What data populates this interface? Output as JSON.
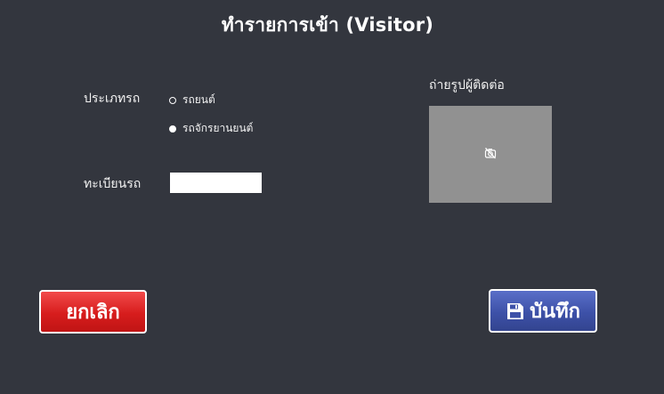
{
  "header": {
    "title": "ทำรายการเข้า (Visitor)"
  },
  "form": {
    "vehicle_type_label": "ประเภทรถ",
    "vehicle_types": [
      {
        "label": "รถยนต์",
        "selected": false
      },
      {
        "label": "รถจักรยานยนต์",
        "selected": true
      }
    ],
    "plate_label": "ทะเบียนรถ",
    "plate_value": "",
    "photo_label": "ถ่ายรูปผู้ติดต่อ",
    "photo_icon": "camera-off-icon"
  },
  "actions": {
    "cancel_label": "ยกเลิก",
    "save_label": "บันทึก",
    "save_icon": "floppy-disk-icon",
    "cancel_color": "#e02222",
    "save_color": "#3f52aa"
  },
  "colors": {
    "background": "#33363e",
    "photo_placeholder": "#919191"
  }
}
